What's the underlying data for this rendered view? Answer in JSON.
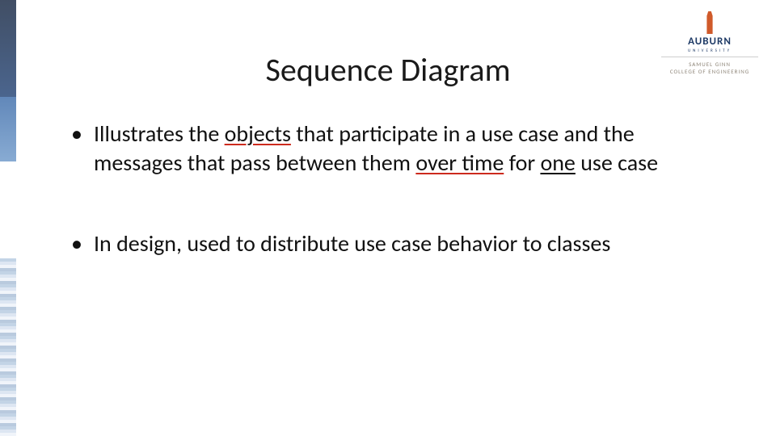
{
  "title": "Sequence Diagram",
  "logo": {
    "wordmark": "AUBURN",
    "university": "UNIVERSITY",
    "coe_line1": "SAMUEL GINN",
    "coe_line2": "COLLEGE OF ENGINEERING"
  },
  "bullets": {
    "b1": {
      "seg1": "Illustrates the ",
      "seg2_underlined_red": "objects",
      "seg3": " that participate in a use case and the messages that pass between them ",
      "seg4_underlined_red": "over time",
      "seg5": " for ",
      "seg6_underlined_black": "one",
      "seg7": " use case"
    },
    "b2": {
      "text": "In design, used to distribute use case behavior to classes"
    }
  }
}
